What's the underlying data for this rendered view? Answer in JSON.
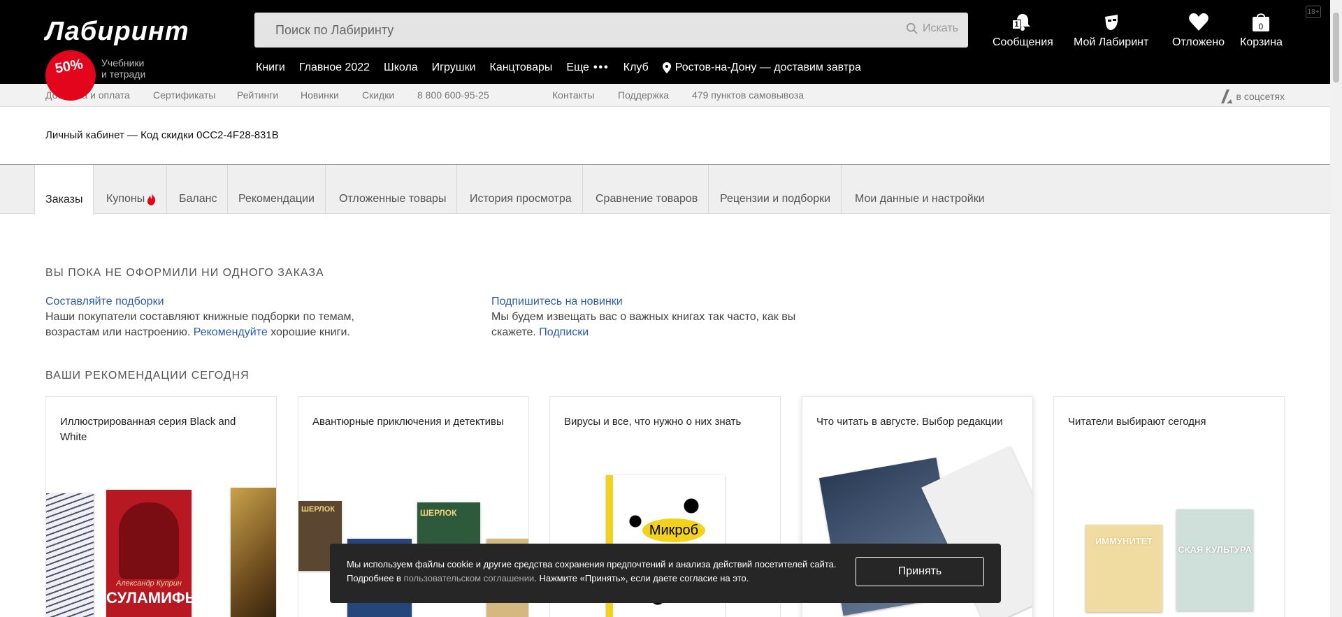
{
  "header": {
    "logo": "Лабиринт",
    "promo_badge": "50%",
    "promo_text_line1": "Учебники",
    "promo_text_line2": "и тетради",
    "search_placeholder": "Поиск по Лабиринту",
    "search_button": "Искать",
    "age_rating": "18+",
    "user_menu": {
      "messages_label": "Сообщения",
      "messages_count": "1",
      "my_labirint_label": "Мой Лабиринт",
      "postponed_label": "Отложено",
      "cart_label": "Корзина",
      "cart_count": "0"
    },
    "nav": {
      "books": "Книги",
      "main2022": "Главное 2022",
      "school": "Школа",
      "toys": "Игрушки",
      "stationery": "Канцтовары",
      "more": "Еще",
      "club": "Клуб",
      "location": "Ростов-на-Дону — доставим завтра"
    }
  },
  "subbar": {
    "delivery": "Доставка и оплата",
    "certificates": "Сертификаты",
    "ratings": "Рейтинги",
    "new": "Новинки",
    "discounts": "Скидки",
    "phone": "8 800 600-95-25",
    "contacts": "Контакты",
    "support": "Поддержка",
    "pickup": "479 пунктов самовывоза",
    "social": "в соцсетях"
  },
  "account": {
    "title": "Личный кабинет — Код скидки 0CC2-4F28-831B",
    "tabs": [
      {
        "label": "Заказы"
      },
      {
        "label": "Купоны"
      },
      {
        "label": "Баланс"
      },
      {
        "label": "Рекомендации"
      },
      {
        "label": "Отложенные товары"
      },
      {
        "label": "История просмотра"
      },
      {
        "label": "Сравнение товаров"
      },
      {
        "label": "Рецензии и подборки"
      },
      {
        "label": "Мои данные и настройки"
      }
    ]
  },
  "orders": {
    "empty_heading": "Вы пока не оформили ни одного заказа",
    "left": {
      "title": "Составляйте подборки",
      "text_before": "Наши покупатели составляют книжные подборки по темам, возрастам или настроению.",
      "link": "Рекомендуйте",
      "text_after": "хорошие книги."
    },
    "right": {
      "title": "Подпишитесь на новинки",
      "text_before": "Мы будем извещать вас о важных книгах так часто, как вы скажете.",
      "link": "Подписки"
    }
  },
  "recommendations": {
    "heading": "Ваши рекомендации сегодня",
    "cards": [
      {
        "title": "Иллюстрированная серия Black and White"
      },
      {
        "title": "Авантюрные приключения и детективы"
      },
      {
        "title": "Вирусы и все, что нужно о них знать"
      },
      {
        "title": "Что читать в августе. Выбор редакции"
      },
      {
        "title": "Читатели выбирают сегодня"
      }
    ],
    "book_texts": {
      "suламиф_author": "Александр Куприн",
      "suламиф_title": "СУЛАМИФЬ",
      "holmes_title": "ШЕРЛОК",
      "micro_title": "Микроб",
      "immunity_title": "ИММУНИТЕТ",
      "culture_title": "СКАЯ КУЛЬТУРА"
    }
  },
  "cookie": {
    "text_before": "Мы используем файлы cookie и другие средства сохранения предпочтений и анализа действий посетителей сайта. Подробнее в",
    "link": "пользовательском соглашении",
    "text_after": ". Нажмите «Принять», если даете согласие на это.",
    "accept_button": "Принять"
  }
}
